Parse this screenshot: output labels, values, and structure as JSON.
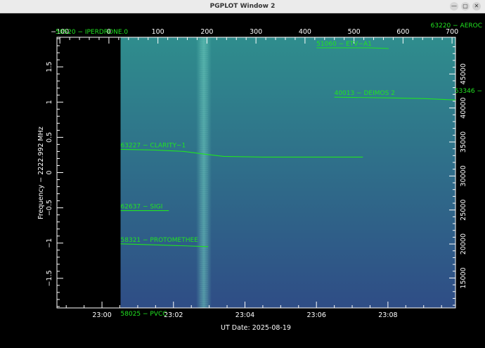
{
  "window": {
    "title": "PGPLOT Window 2",
    "minimize_glyph": "—",
    "maximize_glyph": "▢",
    "close_glyph": "✕"
  },
  "colors": {
    "background": "#000000",
    "axes": "#ffffff",
    "annotation": "#21e321",
    "spectrogram_top": "#2f8d8d",
    "spectrogram_bottom": "#2f4d86"
  },
  "chart_data": {
    "type": "heatmap",
    "xlabel": "UT Date: 2025-08-19",
    "ylabel": "Frequency − 2222.992 MHz",
    "x_time_ticks": [
      "23:00",
      "23:02",
      "23:04",
      "23:06",
      "23:08"
    ],
    "x_time_tick_minutes": [
      1380,
      1382,
      1384,
      1386,
      1388
    ],
    "x_time_range_minutes": [
      1378.74,
      1389.89
    ],
    "x_data_start_minutes": 1380.52,
    "y_left_ticks": [
      -1.5,
      -1,
      -0.5,
      0,
      0.5,
      1,
      1.5
    ],
    "y_left_tick_labels": [
      "−1.5",
      "−1",
      "−0.5",
      "0",
      "0.5",
      "1",
      "1.5"
    ],
    "y_left_range": [
      -1.92,
      1.92
    ],
    "x_top_ticks": [
      -100,
      0,
      100,
      200,
      300,
      400,
      500,
      600,
      700
    ],
    "x_top_tick_labels": [
      "−100",
      "0",
      "100",
      "200",
      "300",
      "400",
      "500",
      "600",
      "700"
    ],
    "x_top_range": [
      -106,
      707
    ],
    "y_right_ticks": [
      15000,
      20000,
      25000,
      30000,
      35000,
      40000,
      45000
    ],
    "y_right_range": [
      10600,
      50400
    ],
    "bright_band_minutes": 1382.85,
    "satellites": [
      {
        "label": "50520 − IPERDRONE.0",
        "minutes": [
          1378.7,
          1380.52
        ]
      },
      {
        "label": "63220 − AEROC",
        "minutes": [
          1389.89
        ]
      },
      {
        "label": "51060 − ETV−A1",
        "freq": [
          1.77,
          1.77,
          1.76
        ],
        "minutes": [
          1386.0,
          1387.5,
          1388.02
        ]
      },
      {
        "label": "53346 − ",
        "freq": [
          1.1
        ],
        "minutes": [
          1389.89
        ]
      },
      {
        "label": "40013 − DEIMOS 2",
        "freq": [
          1.07,
          1.06,
          1.05,
          1.03
        ],
        "minutes": [
          1386.5,
          1388.0,
          1389.0,
          1389.89
        ]
      },
      {
        "label": "63227 − CLARITY−1",
        "freq": [
          0.33,
          0.32,
          0.3,
          0.26,
          0.23,
          0.22,
          0.22
        ],
        "minutes": [
          1380.52,
          1381.5,
          1382.3,
          1382.9,
          1383.4,
          1384.5,
          1387.3
        ]
      },
      {
        "label": "62637 − SIGI",
        "freq": [
          -0.54,
          -0.54
        ],
        "minutes": [
          1380.52,
          1381.87
        ]
      },
      {
        "label": "58321 − PROTOMETHEE",
        "freq": [
          -1.01,
          -1.03,
          -1.05
        ],
        "minutes": [
          1380.52,
          1381.8,
          1382.97
        ]
      },
      {
        "label": "58025 − PVCC",
        "minutes": [
          1380.52
        ]
      }
    ]
  }
}
